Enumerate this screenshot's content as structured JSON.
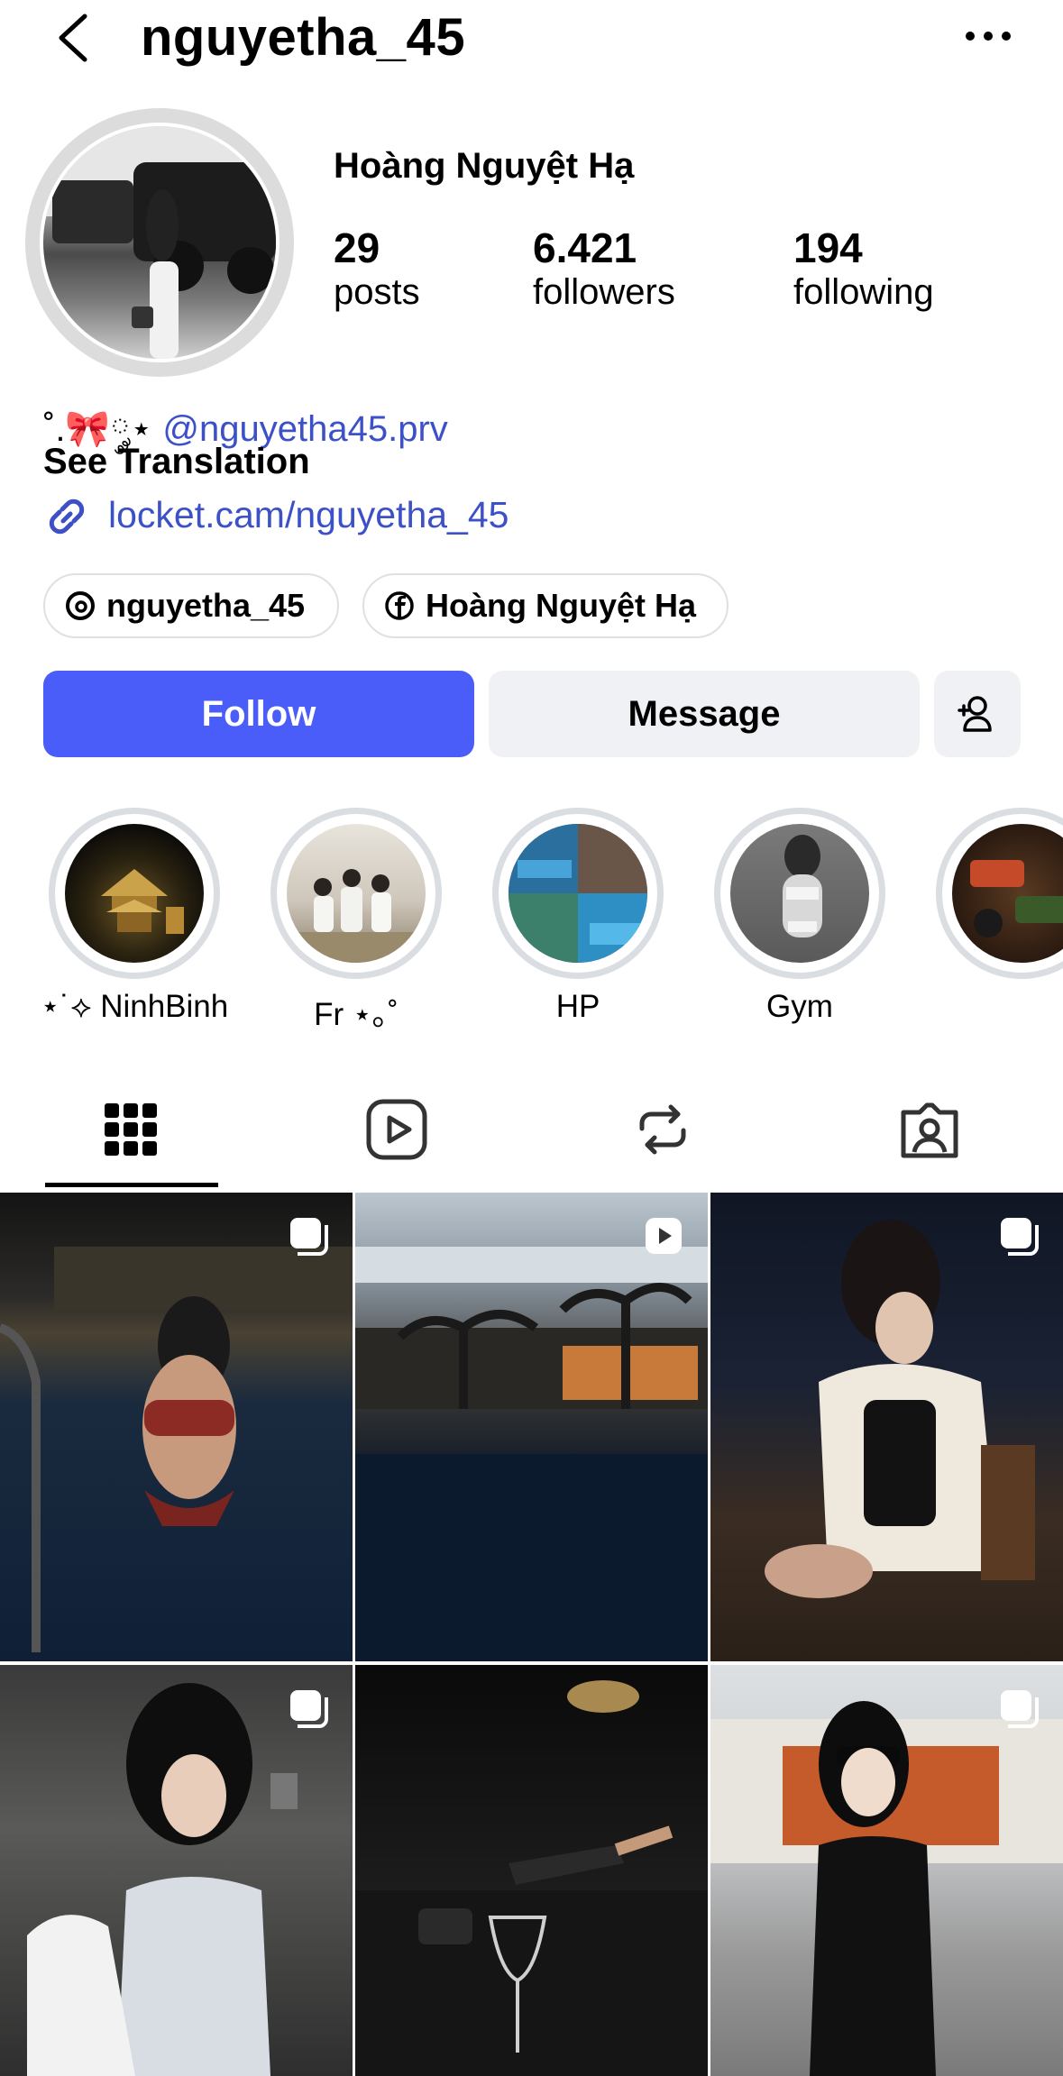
{
  "header": {
    "username": "nguyetha_45"
  },
  "profile": {
    "display_name": "Hoàng Nguyệt Hạ",
    "stats": [
      {
        "value": "29",
        "label": "posts"
      },
      {
        "value": "6.421",
        "label": "followers"
      },
      {
        "value": "194",
        "label": "following"
      }
    ],
    "bio_prefix": "˚.🎀༘⋆",
    "bio_mention": "@nguyetha45.prv",
    "see_translation": "See Translation",
    "link": "locket.cam/nguyetha_45",
    "chips": [
      {
        "label": "nguyetha_45",
        "icon": "threads-icon"
      },
      {
        "label": "Hoàng Nguyệt Hạ",
        "icon": "facebook-icon"
      }
    ]
  },
  "actions": {
    "follow": "Follow",
    "message": "Message",
    "add_user_icon": "add-user-icon"
  },
  "highlights": [
    {
      "label": "⋆˙⟡ NinhBinh"
    },
    {
      "label": "Fr ⋆｡˚"
    },
    {
      "label": "HP"
    },
    {
      "label": "Gym"
    },
    {
      "label": ""
    }
  ],
  "tabs": [
    "grid-icon",
    "reels-icon",
    "reposts-icon",
    "tagged-icon"
  ],
  "colors": {
    "accent": "#4a5df9",
    "link": "#3c50c8",
    "secondary_button": "#eff1f4"
  }
}
